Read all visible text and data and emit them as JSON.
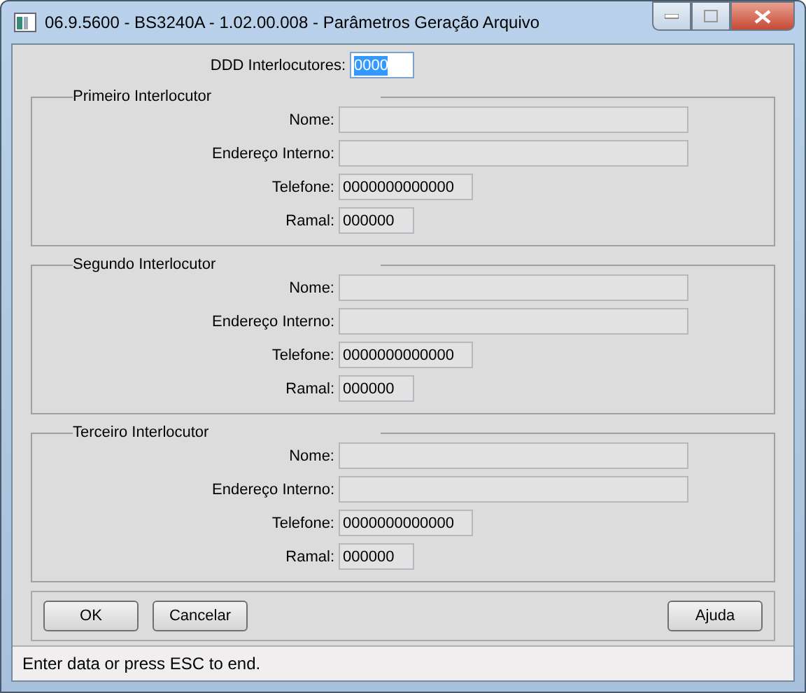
{
  "window": {
    "title": "06.9.5600 - BS3240A - 1.02.00.008 - Parâmetros Geração Arquivo"
  },
  "ddd": {
    "label": "DDD Interlocutores:",
    "value": "0000",
    "text_selected": true
  },
  "groups": [
    {
      "title": "Primeiro Interlocutor",
      "fields": [
        {
          "label": "Nome:",
          "kind": "long"
        },
        {
          "label": "Endereço Interno:",
          "kind": "long"
        },
        {
          "label": "Telefone:",
          "value": "0000000000000",
          "kind": "medium"
        },
        {
          "label": "Ramal:",
          "value": "000000",
          "kind": "short"
        }
      ]
    },
    {
      "title": "Segundo Interlocutor",
      "fields": [
        {
          "label": "Nome:",
          "kind": "long"
        },
        {
          "label": "Endereço Interno:",
          "kind": "long"
        },
        {
          "label": "Telefone:",
          "value": "0000000000000",
          "kind": "medium"
        },
        {
          "label": "Ramal:",
          "value": "000000",
          "kind": "short"
        }
      ]
    },
    {
      "title": "Terceiro Interlocutor",
      "fields": [
        {
          "label": "Nome:",
          "kind": "long"
        },
        {
          "label": "Endereço Interno:",
          "kind": "long"
        },
        {
          "label": "Telefone:",
          "value": "0000000000000",
          "kind": "medium"
        },
        {
          "label": "Ramal:",
          "value": "000000",
          "kind": "short"
        }
      ]
    }
  ],
  "buttons_left": [
    {
      "label": "OK"
    },
    {
      "label": "Cancelar"
    }
  ],
  "buttons_right": [
    {
      "label": "Ajuda"
    }
  ],
  "status_bar": "Enter data or press ESC to end."
}
